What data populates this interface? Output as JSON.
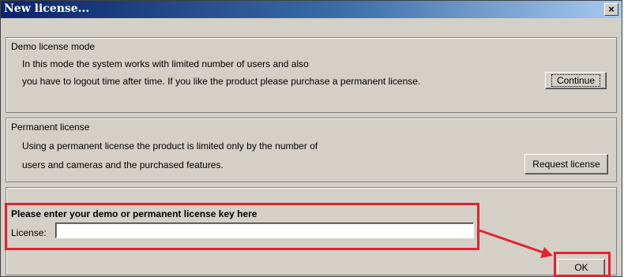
{
  "window": {
    "title": "New license...",
    "close_glyph": "×"
  },
  "demo": {
    "legend": "Demo license mode",
    "line1": "In this mode the system works with limited number of users and also",
    "line2": "you have to logout time after time. If you like the product please purchase a permanent license.",
    "continue_label": "Continue"
  },
  "permanent": {
    "legend": "Permanent license",
    "line1": "Using a permanent license the product is limited only by the number of",
    "line2": "users and cameras and the purchased features.",
    "request_label": "Request license"
  },
  "entry": {
    "heading": "Please enter your demo or permanent license key here",
    "license_label": "License:",
    "license_value": "",
    "ok_label": "OK"
  },
  "annotation": {
    "highlight_color": "#e0242f"
  }
}
